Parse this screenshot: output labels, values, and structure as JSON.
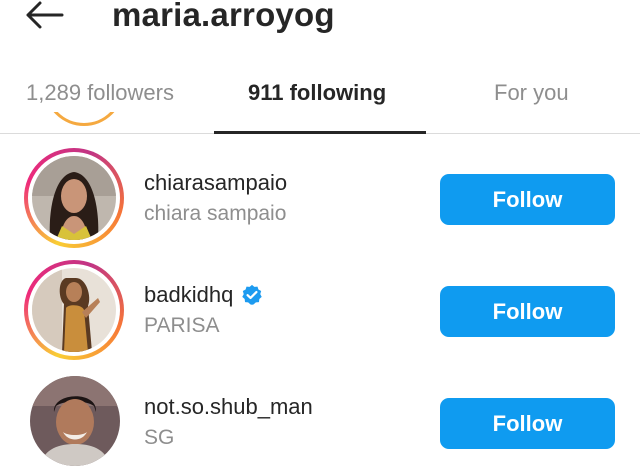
{
  "header": {
    "username": "maria.arroyog",
    "back_icon": "arrow-left-icon"
  },
  "tabs": [
    {
      "label": "1,289 followers",
      "active": false
    },
    {
      "label": "911 following",
      "active": true
    },
    {
      "label": "For you",
      "active": false
    }
  ],
  "accounts": [
    {
      "handle": "chiarasampaio",
      "name": "chiara sampaio",
      "verified": false,
      "button": "Follow",
      "has_story_ring": true
    },
    {
      "handle": "badkidhq",
      "name": "PARISA",
      "verified": true,
      "button": "Follow",
      "has_story_ring": true
    },
    {
      "handle": "not.so.shub_man",
      "name": "SG",
      "verified": false,
      "button": "Follow",
      "has_story_ring": false
    }
  ],
  "colors": {
    "follow_button": "#0f9bf0",
    "text_primary": "#262626",
    "text_secondary": "#8e8e8e",
    "verified_badge": "#1d9bf0"
  }
}
